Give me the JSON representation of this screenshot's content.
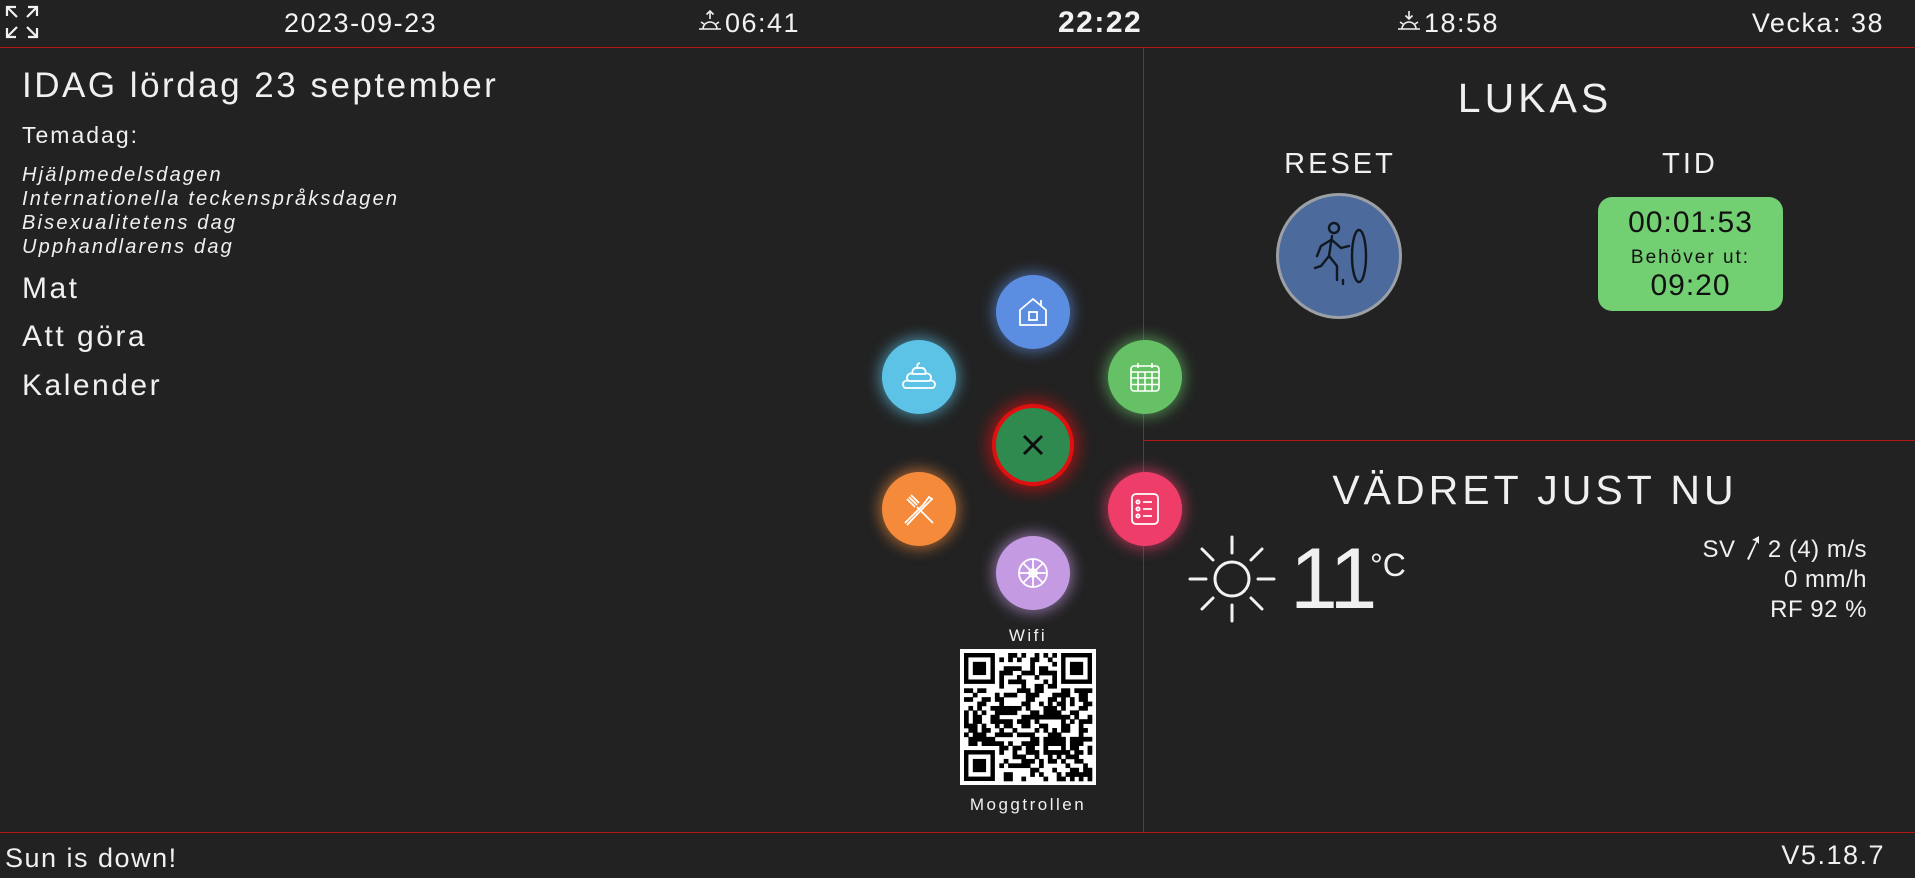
{
  "topbar": {
    "date": "2023-09-23",
    "sunrise": "06:41",
    "time": "22:22",
    "sunset": "18:58",
    "week": "Vecka: 38"
  },
  "left": {
    "today": "IDAG lördag 23 september",
    "temadag_label": "Temadag:",
    "theme_days": [
      "Hjälpmedelsdagen",
      "Internationella teckenspråksdagen",
      "Bisexualitetens dag",
      "Upphandlarens dag"
    ],
    "menu": [
      "Mat",
      "Att göra",
      "Kalender"
    ]
  },
  "radial_menu": {
    "home_color": "#5b8ee0",
    "calendar_color": "#66c066",
    "todo_color": "#ef3d6a",
    "wheel_color": "#c49be3",
    "food_color": "#f58a3a",
    "poop_color": "#5cc3e6",
    "close_color": "#2e8a4e",
    "close_ring_color": "#e01010"
  },
  "wifi": {
    "label": "Wifi",
    "network": "Moggtrollen"
  },
  "timer": {
    "name": "LUKAS",
    "reset_label": "RESET",
    "tid_label": "TID",
    "elapsed": "00:01:53",
    "needs_out_label": "Behöver ut:",
    "needs_out_time": "09:20",
    "box_color": "#72cf72",
    "reset_color": "#4d6a9c"
  },
  "weather": {
    "title": "VÄDRET JUST NU",
    "temperature": "11",
    "unit": "°C",
    "wind_dir": "SV",
    "wind": "2 (4) m/s",
    "rain": "0 mm/h",
    "humidity": "RF 92 %"
  },
  "footer": {
    "status": "Sun is down!",
    "version": "V5.18.7"
  }
}
